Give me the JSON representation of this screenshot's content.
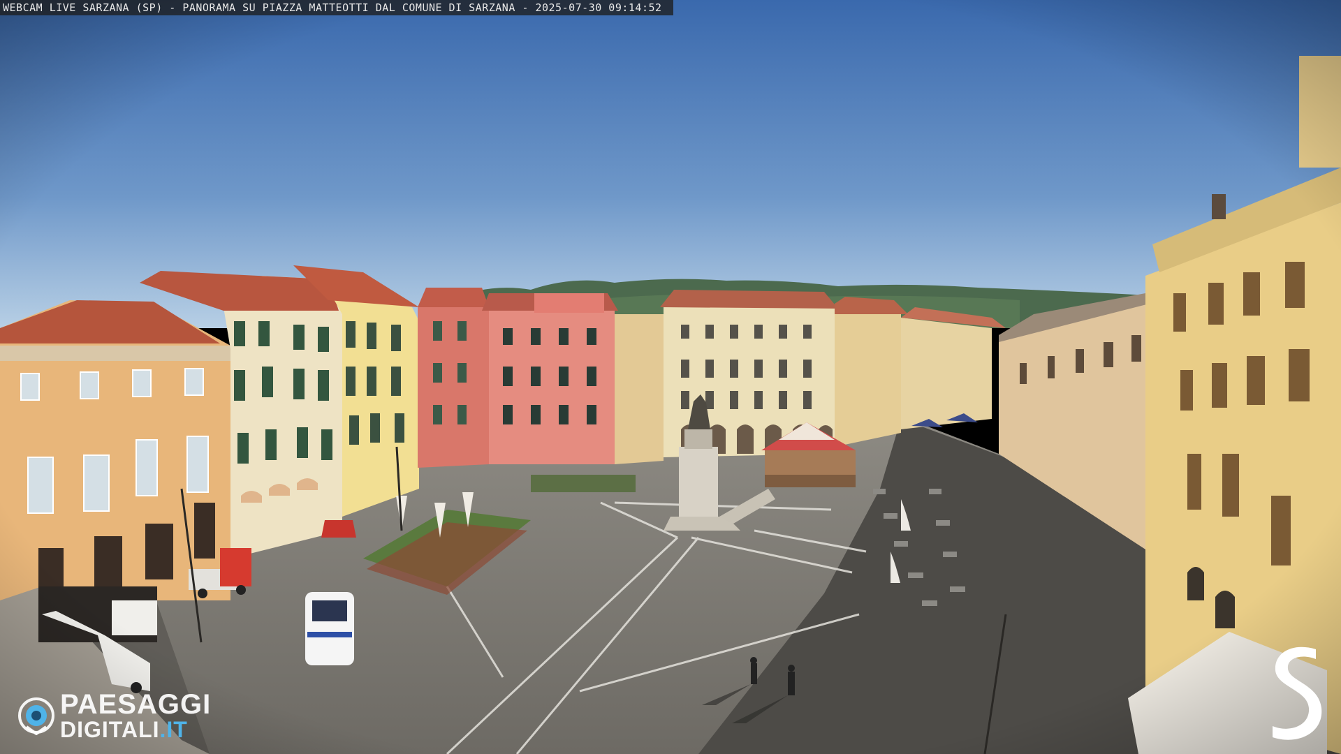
{
  "overlay": {
    "caption": "WEBCAM LIVE SARZANA (SP) - PANORAMA SU PIAZZA MATTEOTTI DAL COMUNE DI SARZANA - 2025-07-30  09:14:52"
  },
  "watermark_left": {
    "line1": "PAESAGGI",
    "line2_main": "DIGITALI",
    "line2_tld": ".IT",
    "icon": "eye-icon",
    "accent_color": "#4fb3e8"
  },
  "watermark_right": {
    "icon": "s-logo"
  },
  "colors": {
    "sky_top": "#3e6fb4",
    "sky_bottom": "#a9c6e2",
    "pavement": "#7d7a74",
    "shadow": "#4a4844",
    "building_ochre": "#e7b77c",
    "building_cream": "#eee2bf",
    "building_yellow": "#f1de8e",
    "building_red": "#d9776a",
    "building_salmon": "#e48c80"
  }
}
